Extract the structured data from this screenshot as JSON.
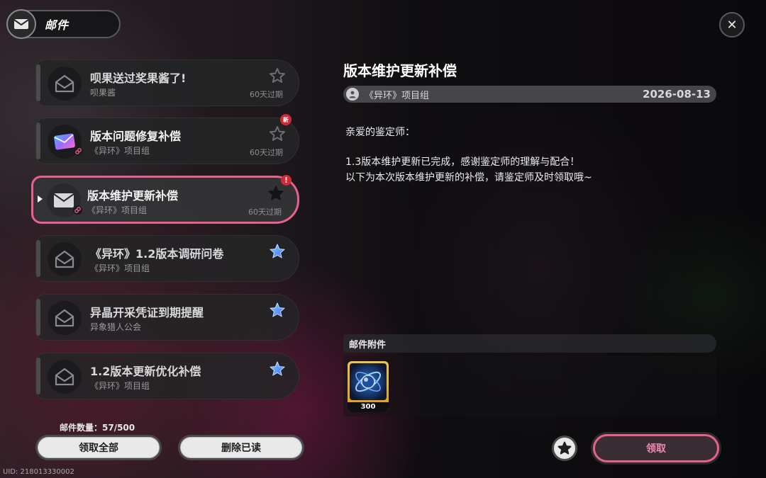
{
  "header": {
    "title": "邮件",
    "icon": "mail-icon",
    "close_icon": "close-icon"
  },
  "mail_list": [
    {
      "title": "呗果送过奖果酱了!",
      "sender": "呗果酱",
      "expire": "60天过期",
      "icon": "envelope-open-icon",
      "star": "outline",
      "read": true
    },
    {
      "title": "版本问题修复补偿",
      "sender": "《异环》项目组",
      "expire": "60天过期",
      "icon": "envelope-colorful-icon",
      "star": "outline",
      "badge": "新",
      "has_link": true
    },
    {
      "title": "版本维护更新补偿",
      "sender": "《异环》项目组",
      "expire": "60天过期",
      "icon": "envelope-closed-icon",
      "star": "filled-dark",
      "badge": "!",
      "selected": true,
      "has_link": true
    },
    {
      "title": "《异环》1.2版本调研问卷",
      "sender": "《异环》项目组",
      "expire": "",
      "icon": "envelope-open-icon",
      "star": "blue",
      "read": true
    },
    {
      "title": "异晶开采凭证到期提醒",
      "sender": "异象猎人公会",
      "expire": "",
      "icon": "envelope-open-icon",
      "star": "blue",
      "read": true
    },
    {
      "title": "1.2版本更新优化补偿",
      "sender": "《异环》项目组",
      "expire": "",
      "icon": "envelope-open-icon",
      "star": "blue",
      "read": true
    }
  ],
  "footer": {
    "count_label": "邮件数量：57/500",
    "claim_all": "领取全部",
    "delete_read": "删除已读",
    "uid": "UID: 218013330002"
  },
  "detail": {
    "title": "版本维护更新补偿",
    "sender": "《异环》项目组",
    "date": "2026-08-13",
    "greeting": "亲爱的鉴定师：",
    "line1": "1.3版本维护更新已完成，感谢鉴定师的理解与配合！",
    "line2": "以下为本次版本维护更新的补偿，请鉴定师及时领取哦~",
    "attach_header": "邮件附件",
    "attachment": {
      "qty": "300",
      "icon": "crystal-orb-icon"
    },
    "claim": "领取"
  },
  "colors": {
    "accent": "#e8608e",
    "star_blue": "#4a8cff",
    "badge_red": "#d02a3a"
  }
}
